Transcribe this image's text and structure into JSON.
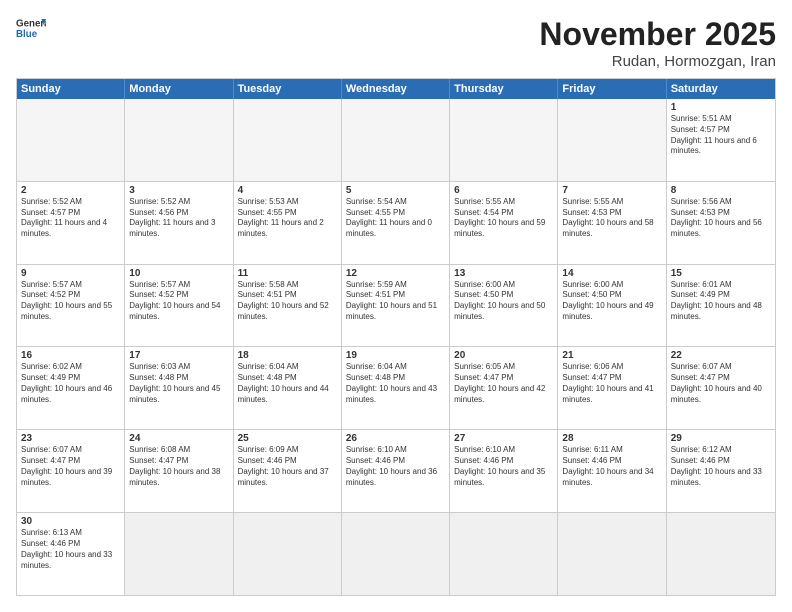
{
  "header": {
    "logo_general": "General",
    "logo_blue": "Blue",
    "month_title": "November 2025",
    "location": "Rudan, Hormozgan, Iran"
  },
  "weekdays": [
    "Sunday",
    "Monday",
    "Tuesday",
    "Wednesday",
    "Thursday",
    "Friday",
    "Saturday"
  ],
  "weeks": [
    [
      {
        "day": "",
        "empty": true
      },
      {
        "day": "",
        "empty": true
      },
      {
        "day": "",
        "empty": true
      },
      {
        "day": "",
        "empty": true
      },
      {
        "day": "",
        "empty": true
      },
      {
        "day": "",
        "empty": true
      },
      {
        "day": "1",
        "sunrise": "5:51 AM",
        "sunset": "4:57 PM",
        "daylight": "11 hours and 6 minutes."
      }
    ],
    [
      {
        "day": "2",
        "sunrise": "5:52 AM",
        "sunset": "4:57 PM",
        "daylight": "11 hours and 4 minutes."
      },
      {
        "day": "3",
        "sunrise": "5:52 AM",
        "sunset": "4:56 PM",
        "daylight": "11 hours and 3 minutes."
      },
      {
        "day": "4",
        "sunrise": "5:53 AM",
        "sunset": "4:55 PM",
        "daylight": "11 hours and 2 minutes."
      },
      {
        "day": "5",
        "sunrise": "5:54 AM",
        "sunset": "4:55 PM",
        "daylight": "11 hours and 0 minutes."
      },
      {
        "day": "6",
        "sunrise": "5:55 AM",
        "sunset": "4:54 PM",
        "daylight": "10 hours and 59 minutes."
      },
      {
        "day": "7",
        "sunrise": "5:55 AM",
        "sunset": "4:53 PM",
        "daylight": "10 hours and 58 minutes."
      },
      {
        "day": "8",
        "sunrise": "5:56 AM",
        "sunset": "4:53 PM",
        "daylight": "10 hours and 56 minutes."
      }
    ],
    [
      {
        "day": "9",
        "sunrise": "5:57 AM",
        "sunset": "4:52 PM",
        "daylight": "10 hours and 55 minutes."
      },
      {
        "day": "10",
        "sunrise": "5:57 AM",
        "sunset": "4:52 PM",
        "daylight": "10 hours and 54 minutes."
      },
      {
        "day": "11",
        "sunrise": "5:58 AM",
        "sunset": "4:51 PM",
        "daylight": "10 hours and 52 minutes."
      },
      {
        "day": "12",
        "sunrise": "5:59 AM",
        "sunset": "4:51 PM",
        "daylight": "10 hours and 51 minutes."
      },
      {
        "day": "13",
        "sunrise": "6:00 AM",
        "sunset": "4:50 PM",
        "daylight": "10 hours and 50 minutes."
      },
      {
        "day": "14",
        "sunrise": "6:00 AM",
        "sunset": "4:50 PM",
        "daylight": "10 hours and 49 minutes."
      },
      {
        "day": "15",
        "sunrise": "6:01 AM",
        "sunset": "4:49 PM",
        "daylight": "10 hours and 48 minutes."
      }
    ],
    [
      {
        "day": "16",
        "sunrise": "6:02 AM",
        "sunset": "4:49 PM",
        "daylight": "10 hours and 46 minutes."
      },
      {
        "day": "17",
        "sunrise": "6:03 AM",
        "sunset": "4:48 PM",
        "daylight": "10 hours and 45 minutes."
      },
      {
        "day": "18",
        "sunrise": "6:04 AM",
        "sunset": "4:48 PM",
        "daylight": "10 hours and 44 minutes."
      },
      {
        "day": "19",
        "sunrise": "6:04 AM",
        "sunset": "4:48 PM",
        "daylight": "10 hours and 43 minutes."
      },
      {
        "day": "20",
        "sunrise": "6:05 AM",
        "sunset": "4:47 PM",
        "daylight": "10 hours and 42 minutes."
      },
      {
        "day": "21",
        "sunrise": "6:06 AM",
        "sunset": "4:47 PM",
        "daylight": "10 hours and 41 minutes."
      },
      {
        "day": "22",
        "sunrise": "6:07 AM",
        "sunset": "4:47 PM",
        "daylight": "10 hours and 40 minutes."
      }
    ],
    [
      {
        "day": "23",
        "sunrise": "6:07 AM",
        "sunset": "4:47 PM",
        "daylight": "10 hours and 39 minutes."
      },
      {
        "day": "24",
        "sunrise": "6:08 AM",
        "sunset": "4:47 PM",
        "daylight": "10 hours and 38 minutes."
      },
      {
        "day": "25",
        "sunrise": "6:09 AM",
        "sunset": "4:46 PM",
        "daylight": "10 hours and 37 minutes."
      },
      {
        "day": "26",
        "sunrise": "6:10 AM",
        "sunset": "4:46 PM",
        "daylight": "10 hours and 36 minutes."
      },
      {
        "day": "27",
        "sunrise": "6:10 AM",
        "sunset": "4:46 PM",
        "daylight": "10 hours and 35 minutes."
      },
      {
        "day": "28",
        "sunrise": "6:11 AM",
        "sunset": "4:46 PM",
        "daylight": "10 hours and 34 minutes."
      },
      {
        "day": "29",
        "sunrise": "6:12 AM",
        "sunset": "4:46 PM",
        "daylight": "10 hours and 33 minutes."
      }
    ],
    [
      {
        "day": "30",
        "sunrise": "6:13 AM",
        "sunset": "4:46 PM",
        "daylight": "10 hours and 33 minutes."
      },
      {
        "day": "",
        "empty": true
      },
      {
        "day": "",
        "empty": true
      },
      {
        "day": "",
        "empty": true
      },
      {
        "day": "",
        "empty": true
      },
      {
        "day": "",
        "empty": true
      },
      {
        "day": "",
        "empty": true
      }
    ]
  ]
}
